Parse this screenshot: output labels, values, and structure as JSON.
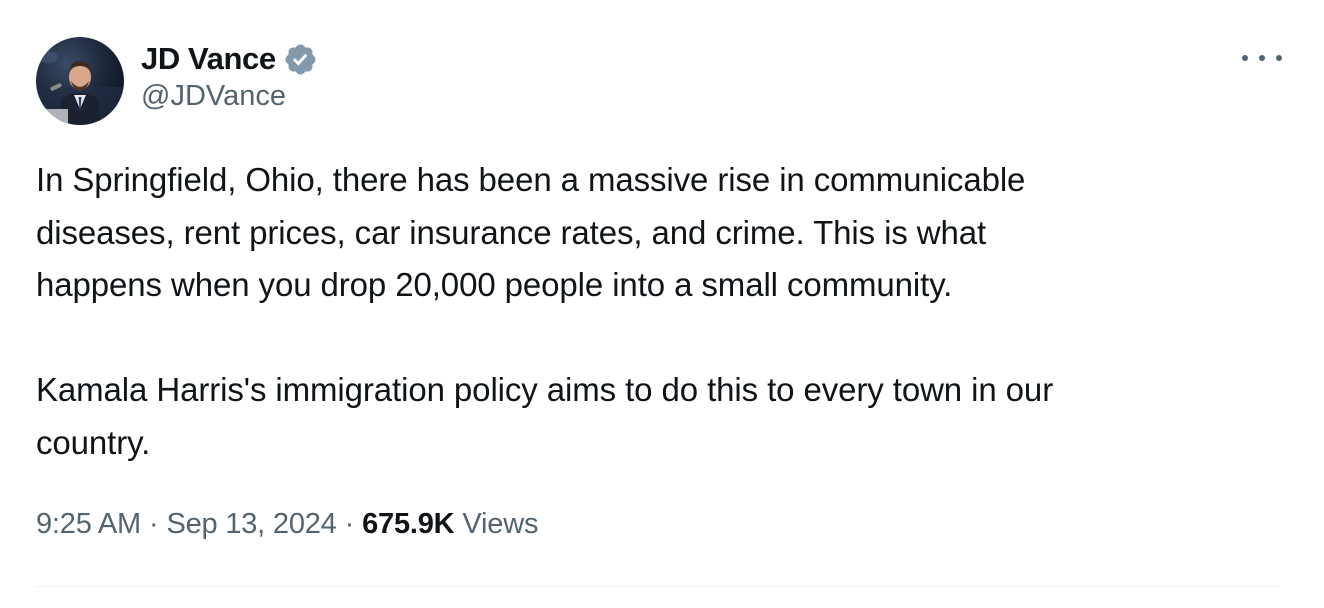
{
  "author": {
    "display_name": "JD Vance",
    "handle": "@JDVance",
    "verified": true
  },
  "tweet": {
    "paragraphs": [
      "In Springfield, Ohio, there has been a massive rise in communicable\ndiseases, rent prices, car insurance rates, and crime. This is what\nhappens when you drop 20,000 people into a small community.",
      "Kamala Harris's immigration policy aims to do this to every town in our\ncountry."
    ]
  },
  "meta": {
    "time": "9:25 AM",
    "separator": "·",
    "date": "Sep 13, 2024",
    "views_count": "675.9K",
    "views_label": "Views"
  },
  "icons": {
    "verified": "verified-badge-icon",
    "more": "more-options-icon"
  },
  "colors": {
    "verified_blue": "#829aab",
    "secondary_text": "#536471",
    "primary_text": "#0f1419"
  }
}
